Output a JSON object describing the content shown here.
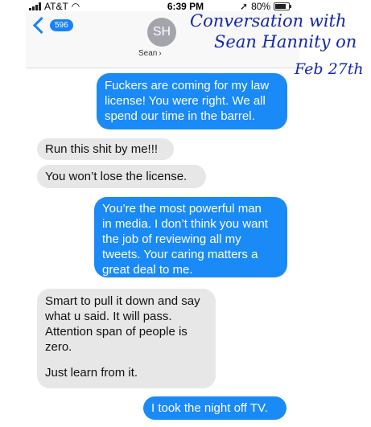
{
  "status_bar": {
    "carrier": "AT&T",
    "time": "6:39 PM",
    "battery": "80%",
    "battery_level": 0.8
  },
  "header": {
    "back_count": "596",
    "avatar_initials": "SH",
    "contact_name": "Sean"
  },
  "annotation": {
    "line1": "Conversation with",
    "line2": "Sean Hannity on",
    "line3": "Feb 27th"
  },
  "messages": [
    {
      "type": "sent",
      "lines": [
        "Fuckers are coming for my law",
        "license! You were right. We all",
        "spend our time in the barrel."
      ]
    },
    {
      "type": "received",
      "lines": [
        "Run this shit by me!!!"
      ]
    },
    {
      "type": "received",
      "lines": [
        "You won’t lose the license."
      ]
    },
    {
      "type": "sent",
      "lines": [
        "You’re the most powerful man",
        "in media. I don’t think you want",
        "the job of reviewing all my",
        "tweets. Your caring matters a",
        "great deal to me."
      ]
    },
    {
      "type": "received",
      "lines": [
        "Smart to pull it down and say",
        "what u said. It will pass.",
        "Attention span of people is",
        "zero.",
        "Just learn from it."
      ]
    },
    {
      "type": "sent",
      "lines": [
        "I took the night off TV."
      ]
    }
  ],
  "colors": {
    "sent_bubble": "#1a8af6",
    "received_bubble": "#e7e7e7",
    "annotation_ink": "#1428a8",
    "accent": "#1a82f5"
  }
}
